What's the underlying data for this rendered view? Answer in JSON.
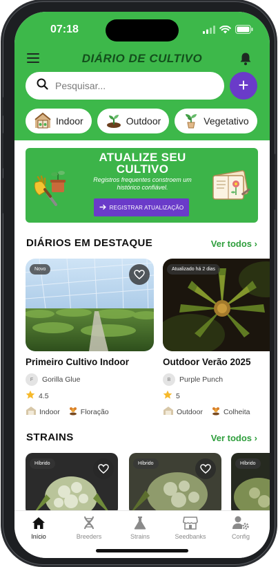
{
  "status_bar": {
    "time": "07:18"
  },
  "header": {
    "title": "DIÁRIO DE CULTIVO",
    "search_placeholder": "Pesquisar...",
    "add_label": "+",
    "chips": [
      {
        "label": "Indoor",
        "icon": "greenhouse-icon"
      },
      {
        "label": "Outdoor",
        "icon": "sprout-icon"
      },
      {
        "label": "Vegetativo",
        "icon": "potted-plant-icon"
      }
    ]
  },
  "banner": {
    "title_line1": "ATUALIZE SEU",
    "title_line2": "CULTIVO",
    "subtitle_line1": "Registros frequentes constroem um",
    "subtitle_line2": "histórico confiável.",
    "button_label": "REGISTRAR ATUALIZAÇÃO"
  },
  "featured": {
    "title": "DIÁRIOS EM DESTAQUE",
    "see_all": "Ver todos",
    "cards": [
      {
        "tag": "Novo",
        "title": "Primeiro Cultivo Indoor",
        "avatar": "F",
        "strain": "Gorilla Glue",
        "rating": "4.5",
        "environment": "Indoor",
        "phase": "Floração"
      },
      {
        "tag": "Atualizado há 2 dias",
        "title": "Outdoor Verão 2025",
        "avatar": "B",
        "strain": "Purple Punch",
        "rating": "5",
        "environment": "Outdoor",
        "phase": "Colheita"
      }
    ]
  },
  "strains": {
    "title": "STRAINS",
    "see_all": "Ver todos",
    "cards": [
      {
        "tag": "Híbrido"
      },
      {
        "tag": "Híbrido"
      },
      {
        "tag": "Híbrido"
      }
    ]
  },
  "bottom_nav": [
    {
      "label": "Início",
      "icon": "home-icon",
      "active": true
    },
    {
      "label": "Breeders",
      "icon": "dna-icon",
      "active": false
    },
    {
      "label": "Strains",
      "icon": "flask-icon",
      "active": false
    },
    {
      "label": "Seedbanks",
      "icon": "storefront-icon",
      "active": false
    },
    {
      "label": "Config",
      "icon": "user-settings-icon",
      "active": false
    }
  ],
  "colors": {
    "brand_green": "#3db84a",
    "accent_purple": "#6a3bc9",
    "link_green": "#2e9e3c",
    "title_dark_green": "#134f1c"
  }
}
